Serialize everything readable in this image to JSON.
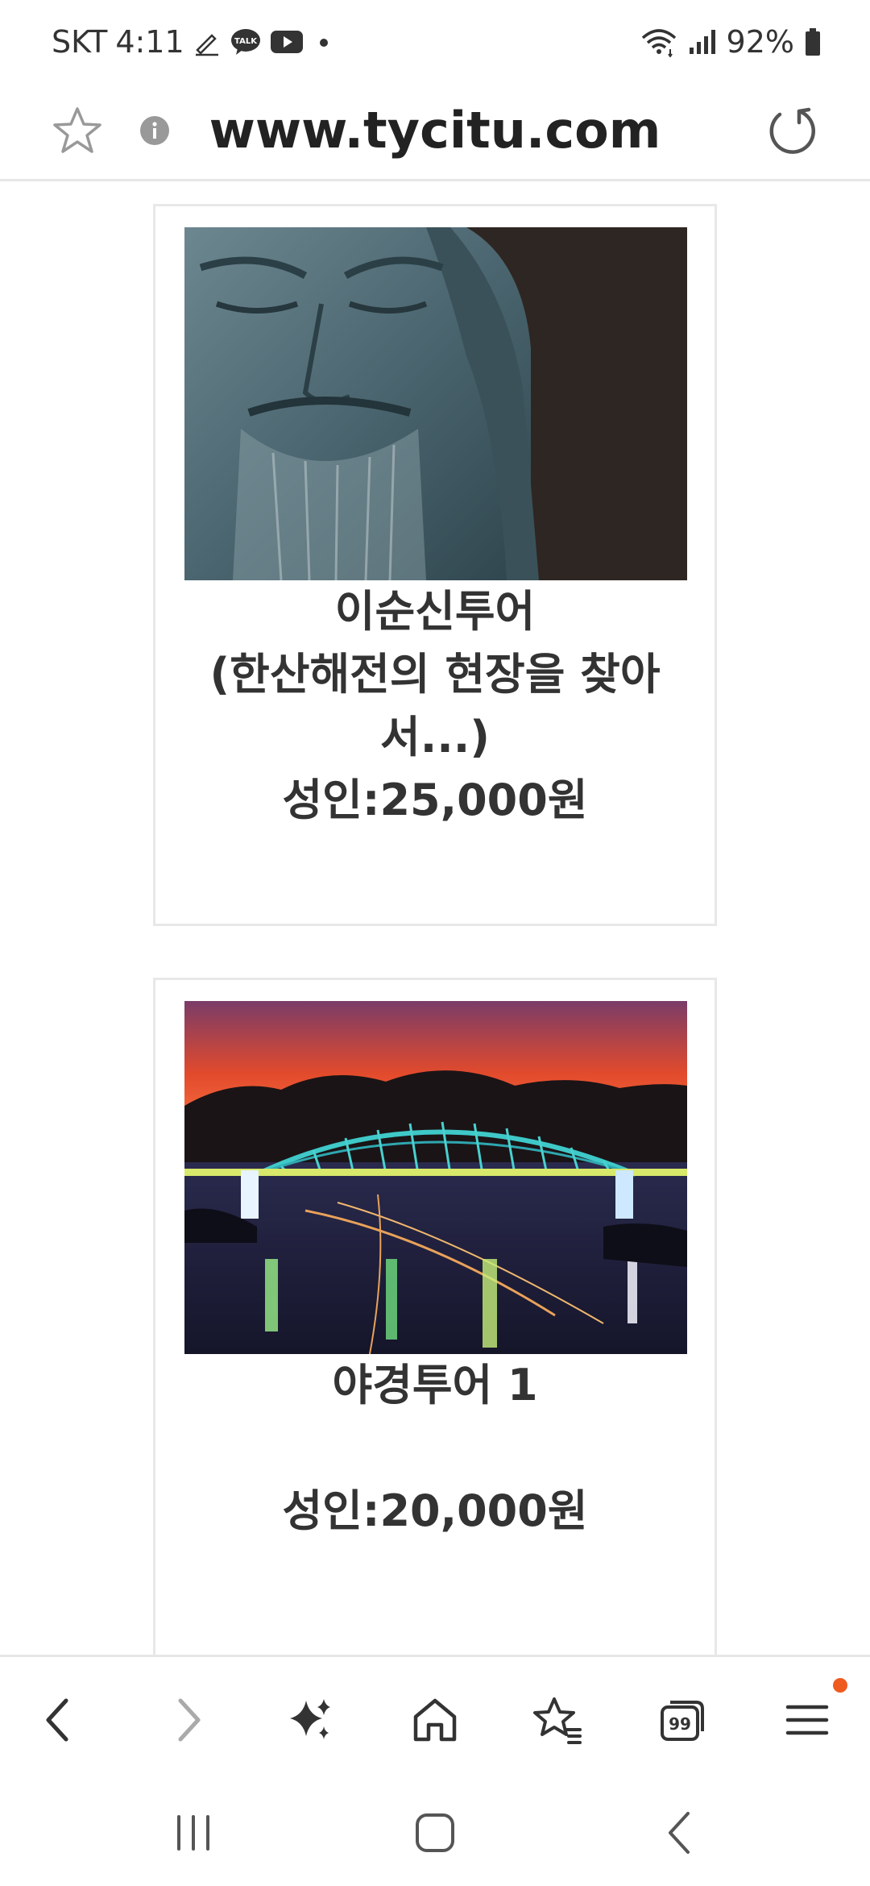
{
  "status_bar": {
    "carrier": "SKT",
    "time": "4:11",
    "battery": "92%",
    "notification_icons": [
      "pen-icon",
      "kakaotalk-icon",
      "youtube-icon",
      "dot-icon"
    ],
    "system_icons": [
      "wifi-icon",
      "signal-icon",
      "battery-icon"
    ]
  },
  "browser": {
    "url": "www.tycitu.com"
  },
  "cards": [
    {
      "title": "이순신투어",
      "subtitle_line1": "(한산해전의 현장을 찾아",
      "subtitle_line2": "서...)",
      "price": "성인:25,000원"
    },
    {
      "title": "야경투어 1",
      "price": "성인:20,000원"
    }
  ],
  "bottom_nav": {
    "items": [
      "back-icon",
      "forward-icon",
      "sparkle-icon",
      "home-icon",
      "bookmark-star-icon",
      "tabs-icon",
      "menu-icon"
    ],
    "tabs_count": "99",
    "menu_badge_color": "#ef5a1e"
  },
  "system_nav": {
    "items": [
      "recent-apps-icon",
      "home-button-icon",
      "back-gesture-icon"
    ]
  }
}
